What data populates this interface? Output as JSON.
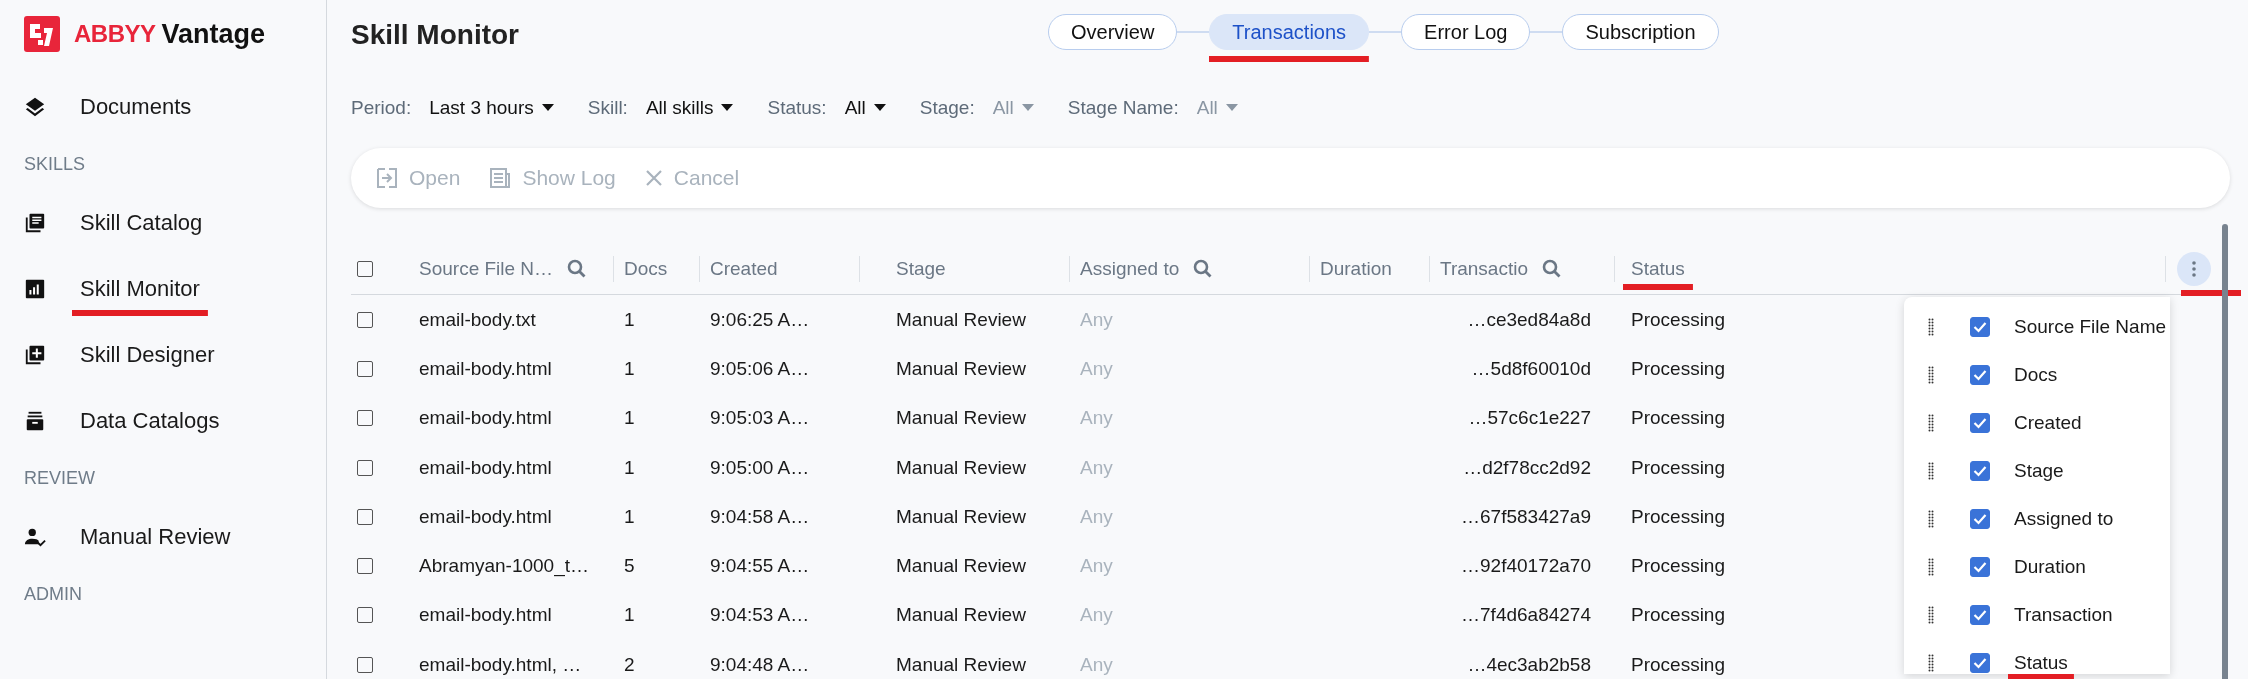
{
  "logo": {
    "brand": "ABBYY",
    "product": "Vantage"
  },
  "sidebar": {
    "sections": [
      {
        "items": [
          {
            "label": "Documents",
            "underlined": false
          }
        ]
      },
      {
        "heading": "SKILLS",
        "items": [
          {
            "label": "Skill Catalog",
            "underlined": false
          },
          {
            "label": "Skill Monitor",
            "underlined": true
          },
          {
            "label": "Skill Designer",
            "underlined": false
          },
          {
            "label": "Data Catalogs",
            "underlined": false
          }
        ]
      },
      {
        "heading": "REVIEW",
        "items": [
          {
            "label": "Manual Review",
            "underlined": false
          }
        ]
      },
      {
        "heading": "ADMIN"
      }
    ]
  },
  "page_title": "Skill Monitor",
  "tabs": [
    {
      "label": "Overview",
      "selected": false,
      "underlined": false
    },
    {
      "label": "Transactions",
      "selected": true,
      "underlined": true
    },
    {
      "label": "Error Log",
      "selected": false,
      "underlined": false
    },
    {
      "label": "Subscription",
      "selected": false,
      "underlined": false
    }
  ],
  "filters": [
    {
      "label": "Period:",
      "value": "Last 3 hours",
      "disabled": false
    },
    {
      "label": "Skill:",
      "value": "All skills",
      "disabled": false
    },
    {
      "label": "Status:",
      "value": "All",
      "disabled": false
    },
    {
      "label": "Stage:",
      "value": "All",
      "disabled": true
    },
    {
      "label": "Stage Name:",
      "value": "All",
      "disabled": true
    }
  ],
  "toolbar": [
    {
      "label": "Open",
      "disabled": true
    },
    {
      "label": "Show Log",
      "disabled": true
    },
    {
      "label": "Cancel",
      "disabled": true
    }
  ],
  "table": {
    "columns": [
      {
        "label": "Source File N…",
        "searchable": true,
        "underlined": false
      },
      {
        "label": "Docs",
        "searchable": false,
        "underlined": false
      },
      {
        "label": "Created",
        "searchable": false,
        "underlined": false
      },
      {
        "label": "Stage",
        "searchable": false,
        "underlined": false
      },
      {
        "label": "Assigned to",
        "searchable": true,
        "underlined": false
      },
      {
        "label": "Duration",
        "searchable": false,
        "underlined": false
      },
      {
        "label": "Transactio",
        "searchable": true,
        "underlined": false
      },
      {
        "label": "Status",
        "searchable": false,
        "underlined": true
      }
    ],
    "menu_button_underlined": true,
    "header_checked": false,
    "rows": [
      {
        "checked": false,
        "source": "email-body.txt",
        "docs": "1",
        "created": "9:06:25 A…",
        "stage": "Manual Review",
        "assigned_to": "Any",
        "transaction": "…ce3ed84a8d",
        "status": "Processing"
      },
      {
        "checked": false,
        "source": "email-body.html",
        "docs": "1",
        "created": "9:05:06 A…",
        "stage": "Manual Review",
        "assigned_to": "Any",
        "transaction": "…5d8f60010d",
        "status": "Processing"
      },
      {
        "checked": false,
        "source": "email-body.html",
        "docs": "1",
        "created": "9:05:03 A…",
        "stage": "Manual Review",
        "assigned_to": "Any",
        "transaction": "…57c6c1e227",
        "status": "Processing"
      },
      {
        "checked": false,
        "source": "email-body.html",
        "docs": "1",
        "created": "9:05:00 A…",
        "stage": "Manual Review",
        "assigned_to": "Any",
        "transaction": "…d2f78cc2d92",
        "status": "Processing"
      },
      {
        "checked": false,
        "source": "email-body.html",
        "docs": "1",
        "created": "9:04:58 A…",
        "stage": "Manual Review",
        "assigned_to": "Any",
        "transaction": "…67f583427a9",
        "status": "Processing"
      },
      {
        "checked": false,
        "source": "Abramyan-1000_t…",
        "docs": "5",
        "created": "9:04:55 A…",
        "stage": "Manual Review",
        "assigned_to": "Any",
        "transaction": "…92f40172a70",
        "status": "Processing"
      },
      {
        "checked": false,
        "source": "email-body.html",
        "docs": "1",
        "created": "9:04:53 A…",
        "stage": "Manual Review",
        "assigned_to": "Any",
        "transaction": "…7f4d6a84274",
        "status": "Processing"
      },
      {
        "checked": false,
        "source": "email-body.html, …",
        "docs": "2",
        "created": "9:04:48 A…",
        "stage": "Manual Review",
        "assigned_to": "Any",
        "transaction": "…4ec3ab2b58",
        "status": "Processing"
      }
    ]
  },
  "column_menu": [
    {
      "label": "Source File Name",
      "checked": true,
      "underlined": false
    },
    {
      "label": "Docs",
      "checked": true,
      "underlined": false
    },
    {
      "label": "Created",
      "checked": true,
      "underlined": false
    },
    {
      "label": "Stage",
      "checked": true,
      "underlined": false
    },
    {
      "label": "Assigned to",
      "checked": true,
      "underlined": false
    },
    {
      "label": "Duration",
      "checked": true,
      "underlined": false
    },
    {
      "label": "Transaction",
      "checked": true,
      "underlined": false
    },
    {
      "label": "Status",
      "checked": true,
      "underlined": true
    }
  ]
}
